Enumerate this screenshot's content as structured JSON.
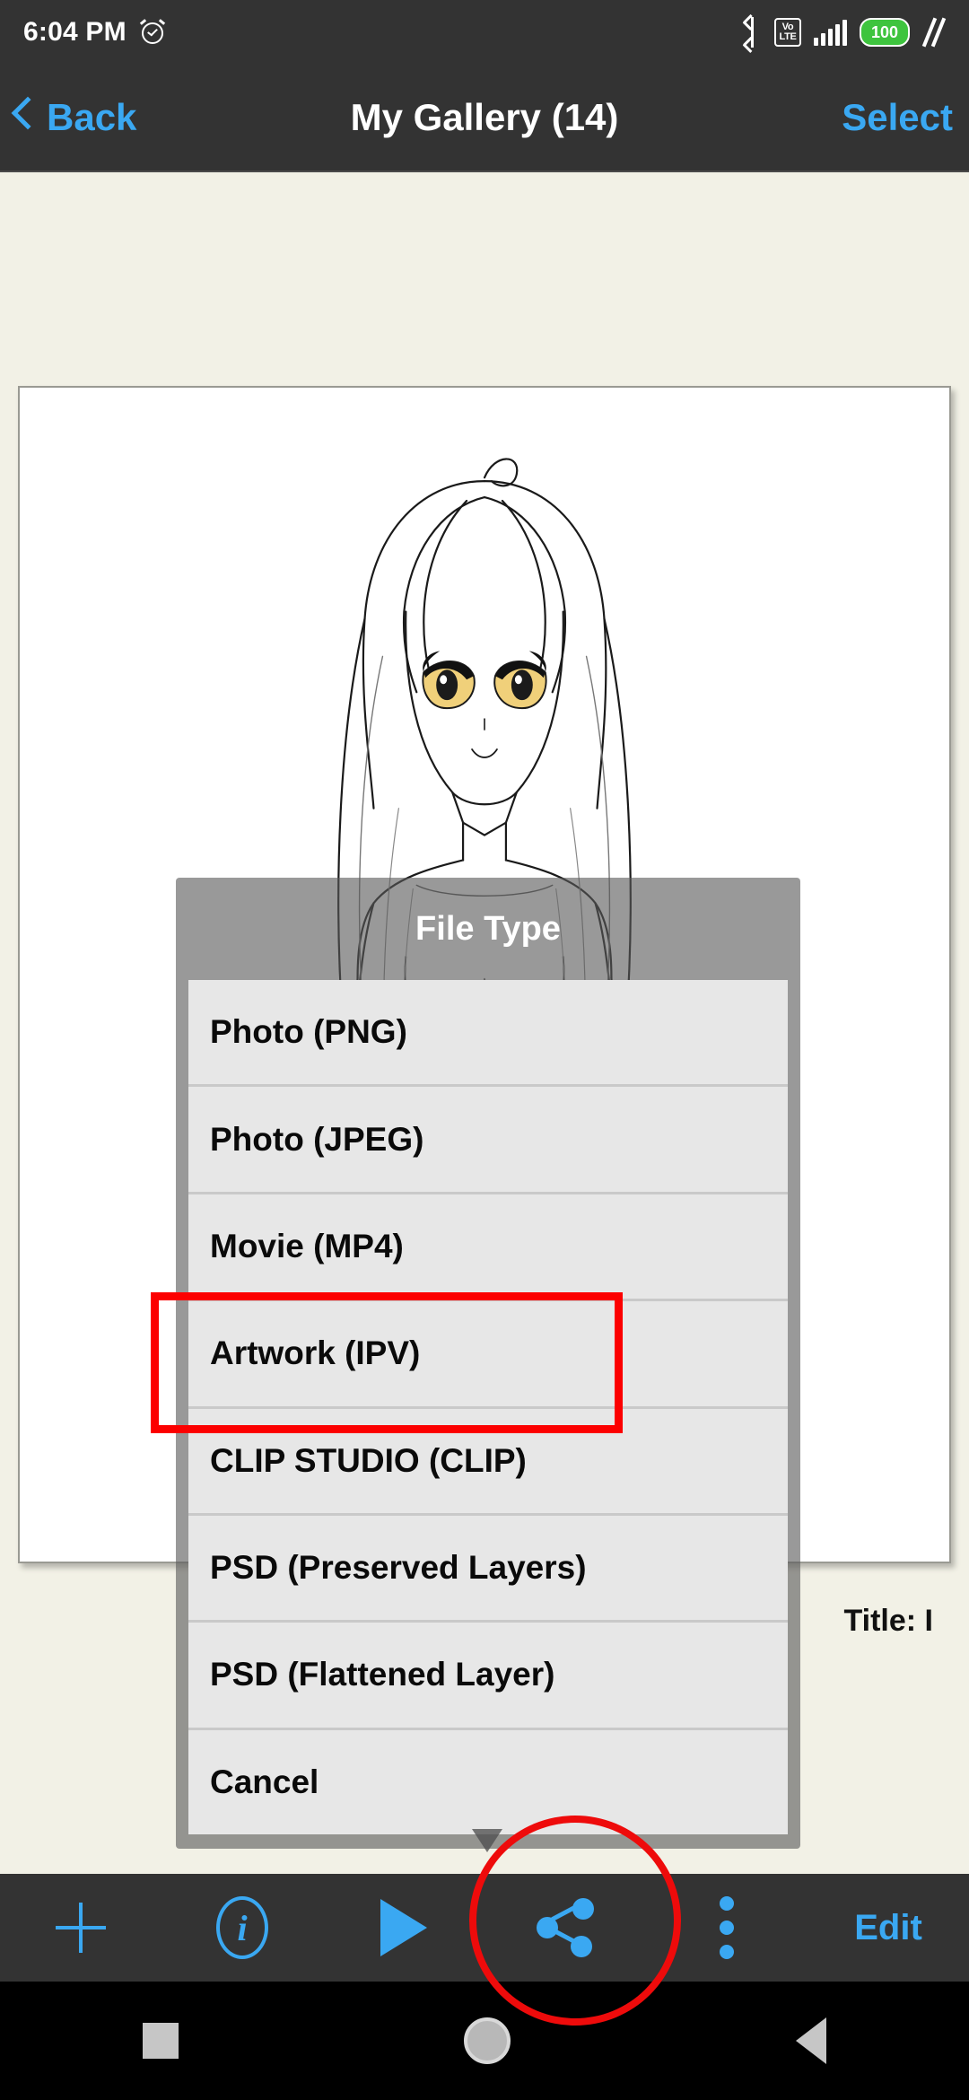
{
  "status_bar": {
    "time": "6:04 PM",
    "alarm_icon": "alarm-clock-icon",
    "bluetooth_icon": "bluetooth-icon",
    "network_label_top": "Vo",
    "network_label_bottom": "LTE",
    "signal_icon": "signal-bars-icon",
    "battery_level": "100",
    "charging_icon": "charging-bolt-icon",
    "colors": {
      "battery_green": "#3ec43e",
      "bar_background": "#333333"
    }
  },
  "nav_bar": {
    "back_label": "Back",
    "title": "My Gallery (14)",
    "select_label": "Select",
    "accent_color": "#3aa8f2"
  },
  "content": {
    "artwork_alt": "anime character line drawing",
    "title_line": "Title: I"
  },
  "dialog": {
    "title": "File Type",
    "items": [
      {
        "label": "Photo (PNG)"
      },
      {
        "label": "Photo (JPEG)"
      },
      {
        "label": "Movie (MP4)"
      },
      {
        "label": "Artwork (IPV)"
      },
      {
        "label": "CLIP STUDIO (CLIP)"
      },
      {
        "label": "PSD (Preserved Layers)"
      },
      {
        "label": "PSD (Flattened Layer)"
      },
      {
        "label": "Cancel"
      }
    ]
  },
  "annotations": {
    "rect_target": "Artwork (IPV)",
    "ellipse_target": "share-button",
    "color": "#fc0000"
  },
  "toolbar": {
    "add_icon": "plus-icon",
    "info_icon": "info-circle-icon",
    "info_glyph": "i",
    "play_icon": "play-icon",
    "share_icon": "share-icon",
    "more_icon": "more-vertical-icon",
    "edit_label": "Edit",
    "accent_color": "#3aa8f2"
  },
  "android_nav": {
    "recents_icon": "square-recents-icon",
    "home_icon": "circle-home-icon",
    "back_icon": "triangle-back-icon"
  }
}
